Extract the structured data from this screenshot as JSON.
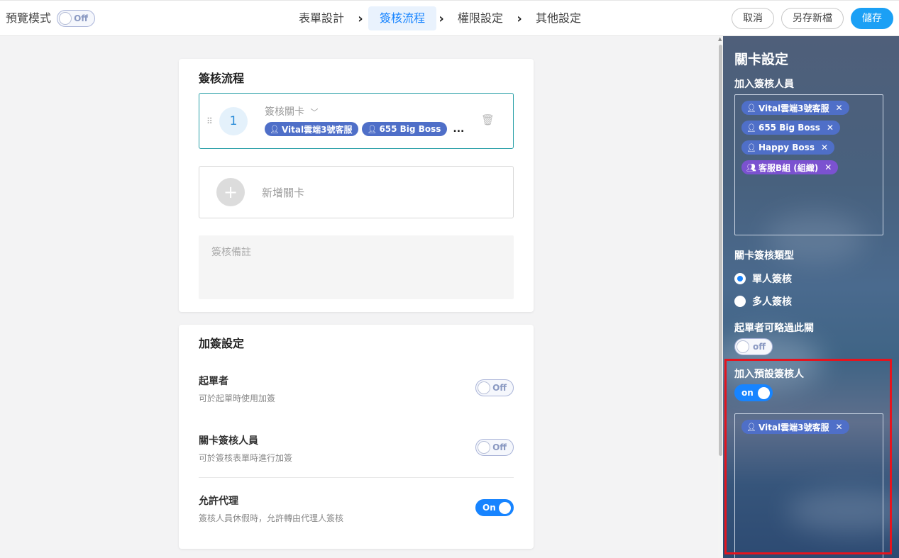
{
  "preview": {
    "label": "預覽模式",
    "toggle": "Off",
    "state": false
  },
  "steps": [
    {
      "label": "表單設計",
      "active": false
    },
    {
      "label": "簽核流程",
      "active": true
    },
    {
      "label": "權限設定",
      "active": false
    },
    {
      "label": "其他設定",
      "active": false
    }
  ],
  "actions": {
    "cancel": "取消",
    "save_as": "另存新檔",
    "save": "儲存"
  },
  "flow_card": {
    "title": "簽核流程",
    "stage": {
      "number": "1",
      "name": "簽核關卡",
      "approvers": [
        "Vital雲端3號客服",
        "655 Big Boss"
      ],
      "more": "..."
    },
    "add_stage": "新增關卡",
    "note_placeholder": "簽核備註"
  },
  "extra_card": {
    "title": "加簽設定",
    "options": [
      {
        "title": "起單者",
        "desc": "可於起單時使用加簽",
        "toggle": "Off",
        "on": false
      },
      {
        "title": "關卡簽核人員",
        "desc": "可於簽核表單時進行加簽",
        "toggle": "Off",
        "on": false
      },
      {
        "title": "允許代理",
        "desc": "簽核人員休假時，允許轉由代理人簽核",
        "toggle": "On",
        "on": true
      }
    ]
  },
  "panel": {
    "title": "關卡設定",
    "approvers_label": "加入簽核人員",
    "approvers": [
      {
        "name": "Vital雲端3號客服",
        "type": "user"
      },
      {
        "name": "655 Big Boss",
        "type": "user"
      },
      {
        "name": "Happy Boss",
        "type": "user"
      },
      {
        "name": "客服B組 (組織)",
        "type": "group"
      }
    ],
    "type_label": "關卡簽核類型",
    "type_options": [
      {
        "label": "單人簽核",
        "selected": true
      },
      {
        "label": "多人簽核",
        "selected": false
      }
    ],
    "skip_label": "起單者可略過此關",
    "skip_toggle": "off",
    "default_label": "加入預設簽核人",
    "default_toggle": "on",
    "default_approvers": [
      {
        "name": "Vital雲端3號客服",
        "type": "user"
      }
    ]
  },
  "colors": {
    "accent": "#1784ff",
    "chip": "#4f6fc8",
    "group_chip": "#7b52d0",
    "highlight": "#e5141e"
  },
  "icons": {
    "user": "person-icon",
    "group": "group-icon",
    "remove": "close-icon",
    "delete": "trash-icon",
    "drag": "drag-handle-icon",
    "add": "plus-icon",
    "next": "chevron-right-icon",
    "expand": "chevron-down-icon"
  }
}
